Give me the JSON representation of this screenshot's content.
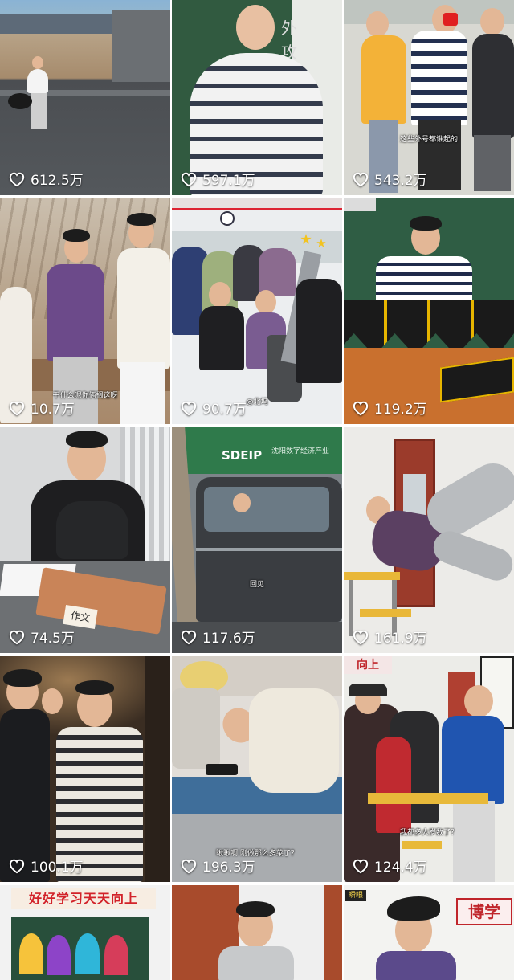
{
  "colors": {
    "like_text": "#ffffff",
    "background": "#ffffff"
  },
  "icon": "heart-outline-icon",
  "tiles": [
    {
      "likes": "612.5万",
      "caption": ""
    },
    {
      "likes": "597.1万",
      "caption": ""
    },
    {
      "likes": "543.2万",
      "caption": "这些外号都谁起的"
    },
    {
      "likes": "10.7万",
      "caption": "干什么呢你俩搁这呀"
    },
    {
      "likes": "90.7万",
      "caption": "@北坞"
    },
    {
      "likes": "119.2万",
      "caption": ""
    },
    {
      "likes": "74.5万",
      "caption": ""
    },
    {
      "likes": "117.6万",
      "caption": "回见"
    },
    {
      "likes": "161.9万",
      "caption": ""
    },
    {
      "likes": "100.1万",
      "caption": ""
    },
    {
      "likes": "196.3万",
      "caption": "瞅瞅啊 刚做那么多菜了？"
    },
    {
      "likes": "124.4万",
      "caption": "我都多大岁数了？"
    },
    {
      "likes": "",
      "caption": ""
    },
    {
      "likes": "",
      "caption": ""
    },
    {
      "likes": "",
      "caption": ""
    }
  ],
  "signs": {
    "tile2_board": "外攻",
    "tile8_banner": "SDEIP",
    "tile8_banner_sub": "沈阳数字经济产业",
    "tile12_sign": "向上",
    "tile13_banner": "好好学习天天向上",
    "tile15_sign": "博学",
    "tile15_corner": "瞬眼",
    "tile7_book": "作文"
  }
}
